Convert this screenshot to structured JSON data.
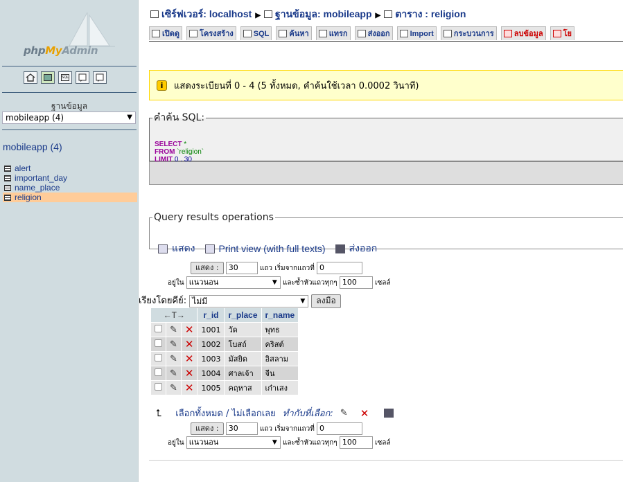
{
  "sidebar": {
    "logo_text_a": "php",
    "logo_text_b": "My",
    "logo_text_c": "Admin",
    "quick_icons": [
      "home-icon",
      "sql-query-icon",
      "sql-window-icon",
      "docs-icon",
      "help-icon"
    ],
    "db_label": "ฐานข้อมูล",
    "db_selected": "mobileapp (4)",
    "db_name": "mobileapp (4)",
    "tables": [
      {
        "name": "alert",
        "active": false
      },
      {
        "name": "important_day",
        "active": false
      },
      {
        "name": "name_place",
        "active": false
      },
      {
        "name": "religion",
        "active": true
      }
    ]
  },
  "breadcrumb": {
    "server": "เซิร์ฟเวอร์: localhost",
    "database": "ฐานข้อมูล: mobileapp",
    "table": "ตาราง : religion"
  },
  "tabs": [
    {
      "label": "เปิดดู",
      "danger": false
    },
    {
      "label": "โครงสร้าง",
      "danger": false
    },
    {
      "label": "SQL",
      "danger": false
    },
    {
      "label": "ค้นหา",
      "danger": false
    },
    {
      "label": "แทรก",
      "danger": false
    },
    {
      "label": "ส่งออก",
      "danger": false
    },
    {
      "label": "Import",
      "danger": false
    },
    {
      "label": "กระบวนการ",
      "danger": false
    },
    {
      "label": "ลบข้อมูล",
      "danger": true
    },
    {
      "label": "โย",
      "danger": true
    }
  ],
  "notice": {
    "text": "แสดงระเบียนที่ 0 - 4 (5 ทั้งหมด, คำค้นใช้เวลา 0.0002 วินาที)"
  },
  "sql_box": {
    "legend": "คำค้น SQL:",
    "select_kw": "SELECT",
    "select_rest": " *",
    "from_kw": "FROM",
    "from_rest": " `religion`",
    "limit_kw": "LIMIT",
    "limit_rest": " 0 , 30"
  },
  "qro": {
    "legend": "Query results operations",
    "show_label": "แสดง",
    "print_label": "Print view (with full texts)",
    "export_label": "ส่งออก"
  },
  "nav": {
    "show_button": "แสดง :",
    "rows_value": "30",
    "rows_label": "แถว เริ่มจากแถวที่",
    "start_value": "0",
    "mode_label": "อยู่ใน",
    "mode_value": "แนวนอน",
    "repeat_label": "และซ้ำหัวแถวทุกๆ",
    "repeat_value": "100",
    "cells_label": "เซลล์"
  },
  "sort": {
    "label": "เรียงโดยคีย์:",
    "value": "ไม่มี",
    "go_button": "ลงมือ"
  },
  "table": {
    "arrows": "←T→",
    "columns": [
      "r_id",
      "r_place",
      "r_name"
    ],
    "rows": [
      [
        "1001",
        "วัด",
        "พุทธ"
      ],
      [
        "1002",
        "โบสถ์",
        "คริสต์"
      ],
      [
        "1003",
        "มัสยิด",
        "อิสลาม"
      ],
      [
        "1004",
        "ศาลเจ้า",
        "จีน"
      ],
      [
        "1005",
        "คฤหาส",
        "เก๋าเสง"
      ]
    ]
  },
  "with_selected": {
    "check_all": "เลือกทั้งหมด",
    "slash": " / ",
    "uncheck_all": "ไม่เลือกเลย",
    "action_label": "ทำกับที่เลือก:"
  }
}
